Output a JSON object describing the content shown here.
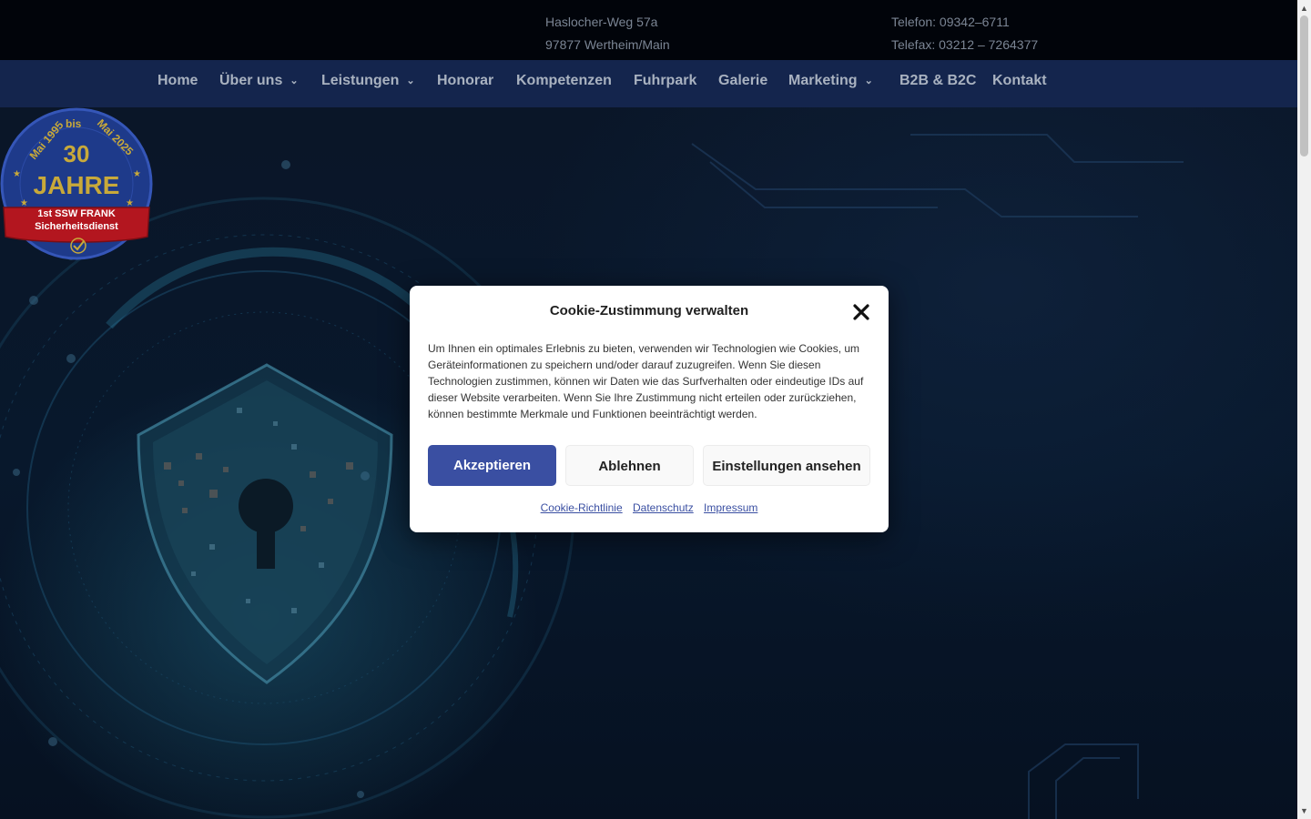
{
  "topbar": {
    "address_line1": "Haslocher-Weg 57a",
    "address_line2": "97877 Wertheim/Main",
    "phone": "Telefon: 09342–6711",
    "fax": "Telefax: 03212 – 7264377"
  },
  "nav": {
    "items": [
      {
        "label": "Home",
        "dropdown": false
      },
      {
        "label": "Über uns",
        "dropdown": true
      },
      {
        "label": "Leistungen",
        "dropdown": true
      },
      {
        "label": "Honorar",
        "dropdown": false
      },
      {
        "label": "Kompetenzen",
        "dropdown": false
      },
      {
        "label": "Fuhrpark",
        "dropdown": false
      },
      {
        "label": "Galerie",
        "dropdown": false
      },
      {
        "label": "Marketing",
        "dropdown": true
      },
      {
        "label": "B2B & B2C",
        "dropdown": false
      },
      {
        "label": "Kontakt",
        "dropdown": false
      }
    ]
  },
  "cookie_modal": {
    "title": "Cookie-Zustimmung verwalten",
    "text": "Um Ihnen ein optimales Erlebnis zu bieten, verwenden wir Technologien wie Cookies, um Geräteinformationen zu speichern und/oder darauf zuzugreifen. Wenn Sie diesen Technologien zustimmen, können wir Daten wie das Surfverhalten oder eindeutige IDs auf dieser Website verarbeiten. Wenn Sie Ihre Zustimmung nicht erteilen oder zurückziehen, können bestimmte Merkmale und Funktionen beeinträchtigt werden.",
    "accept_label": "Akzeptieren",
    "deny_label": "Ablehnen",
    "settings_label": "Einstellungen ansehen",
    "links": [
      "Cookie-Richtlinie",
      "Datenschutz",
      "Impressum"
    ]
  },
  "badge": {
    "arc_left": "Mai 1995",
    "arc_mid": "bis",
    "arc_right": "Mai 2025",
    "number": "30",
    "word": "JAHRE",
    "ribbon_line1": "1st SSW FRANK",
    "ribbon_line2": "Sicherheitsdienst"
  },
  "colors": {
    "accent": "#3a4fa2",
    "navbar": "#14254d",
    "topbar": "#01040a",
    "badge_blue": "#1e3a8a",
    "badge_gold": "#c8a93a",
    "badge_red": "#b3161f"
  },
  "icons": {
    "close": "close-icon",
    "dropdown": "chevron-down-icon",
    "shield": "shield-lock-icon"
  }
}
